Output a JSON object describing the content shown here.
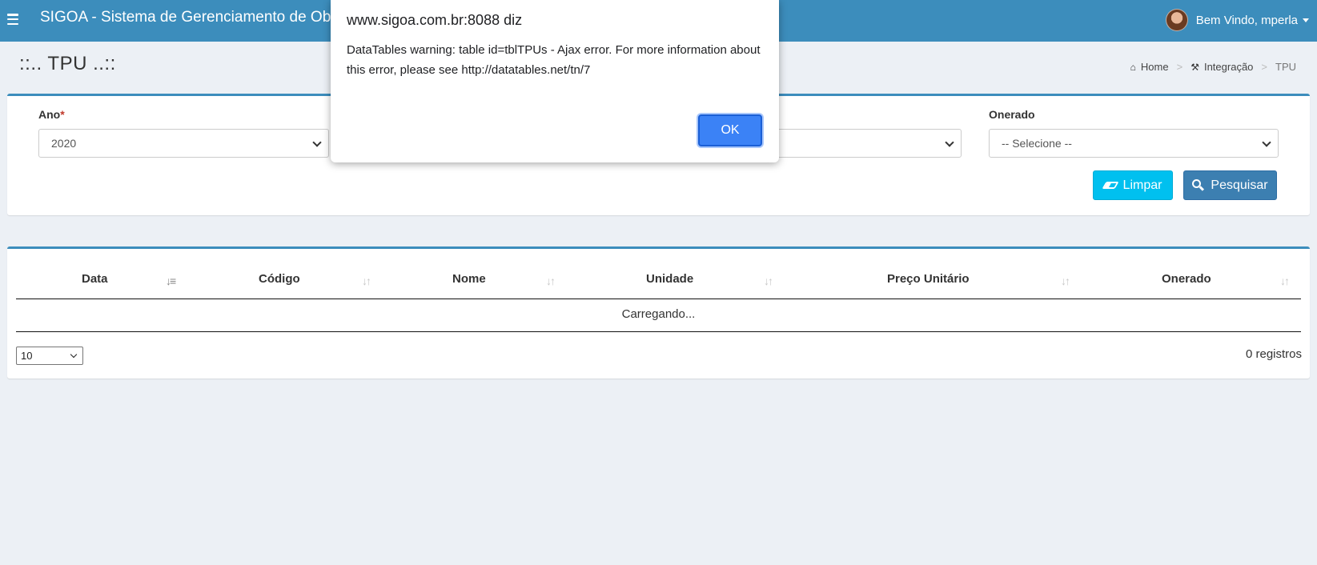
{
  "navbar": {
    "title": "SIGOA - Sistema de Gerenciamento de Obras",
    "welcome": "Bem Vindo, mperla"
  },
  "page": {
    "title": "::.. TPU ..::",
    "breadcrumb": [
      "Home",
      "Integração",
      "TPU"
    ]
  },
  "filters": {
    "ano_label": "Ano",
    "ano_required": "*",
    "ano_value": "2020",
    "onerado_label": "Onerado",
    "onerado_value": "-- Selecione --",
    "limpar_label": "Limpar",
    "pesquisar_label": "Pesquisar"
  },
  "table": {
    "columns": [
      "Data",
      "Código",
      "Nome",
      "Unidade",
      "Preço Unitário",
      "Onerado"
    ],
    "loading_text": "Carregando...",
    "page_length": "10",
    "records": "0 registros"
  },
  "dialog": {
    "title": "www.sigoa.com.br:8088 diz",
    "message": "DataTables warning: table id=tblTPUs - Ajax error. For more information about this error, please see http://datatables.net/tn/7",
    "ok_label": "OK"
  },
  "colors": {
    "navbar": "#3c8dbc",
    "limpar": "#00c0ef",
    "pesquisar": "#3c7fb1",
    "dialog_ok": "#3b82f6"
  }
}
